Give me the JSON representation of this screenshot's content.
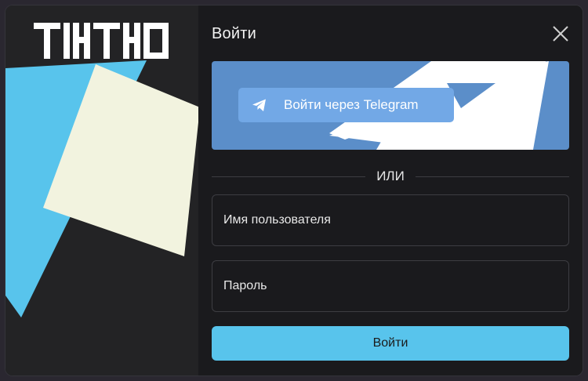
{
  "brand": {
    "logo_text": "TIKTKO"
  },
  "dialog": {
    "title": "Войти",
    "telegram_button": "Войти через Telegram",
    "divider_text": "ИЛИ",
    "username_placeholder": "Имя пользователя",
    "password_placeholder": "Пароль",
    "submit_label": "Войти"
  },
  "icons": {
    "close": "close-icon",
    "telegram": "telegram-plane-icon"
  },
  "colors": {
    "accent": "#58c4ec",
    "telegram_banner": "#5b8ec9",
    "telegram_button": "#72a8e6",
    "art_cream": "#f2f3df",
    "art_blue": "#58c4ec"
  }
}
